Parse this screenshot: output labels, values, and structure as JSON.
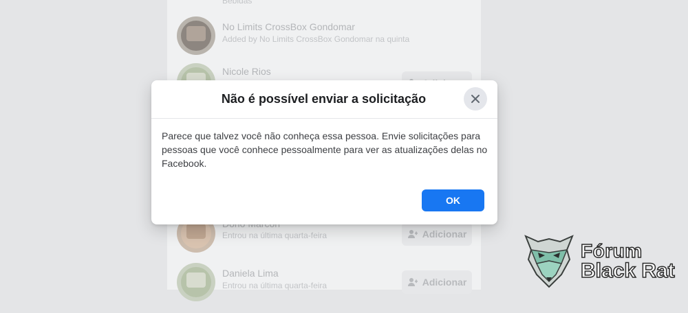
{
  "background_list": {
    "top_partial_text": "Bebidas",
    "items": [
      {
        "name": "No Limits CrossBox Gondomar",
        "subtitle": "Added by No Limits CrossBox Gondomar na quinta",
        "button": ""
      },
      {
        "name": "Nicole Rios",
        "subtitle": "",
        "button": "Adicionar"
      },
      {
        "name": "Dorio Marcon",
        "subtitle": "Entrou na última quarta-feira",
        "button": "Adicionar"
      },
      {
        "name": "Daniela Lima",
        "subtitle": "Entrou na última quarta-feira",
        "button": "Adicionar"
      }
    ]
  },
  "dialog": {
    "title": "Não é possível enviar a solicitação",
    "message": "Parece que talvez você não conheça essa pessoa. Envie solicitações para pessoas que você conhece pessoalmente para ver as atualizações delas no Facebook.",
    "ok_label": "OK",
    "close_icon": "close-icon"
  },
  "watermark": {
    "line1": "Fórum",
    "line2": "Black Rat",
    "logo_icon": "rat-head-logo"
  },
  "colors": {
    "primary_button": "#1877f2",
    "overlay_background": "#e4e5e7",
    "title_text": "#1c1e21"
  }
}
